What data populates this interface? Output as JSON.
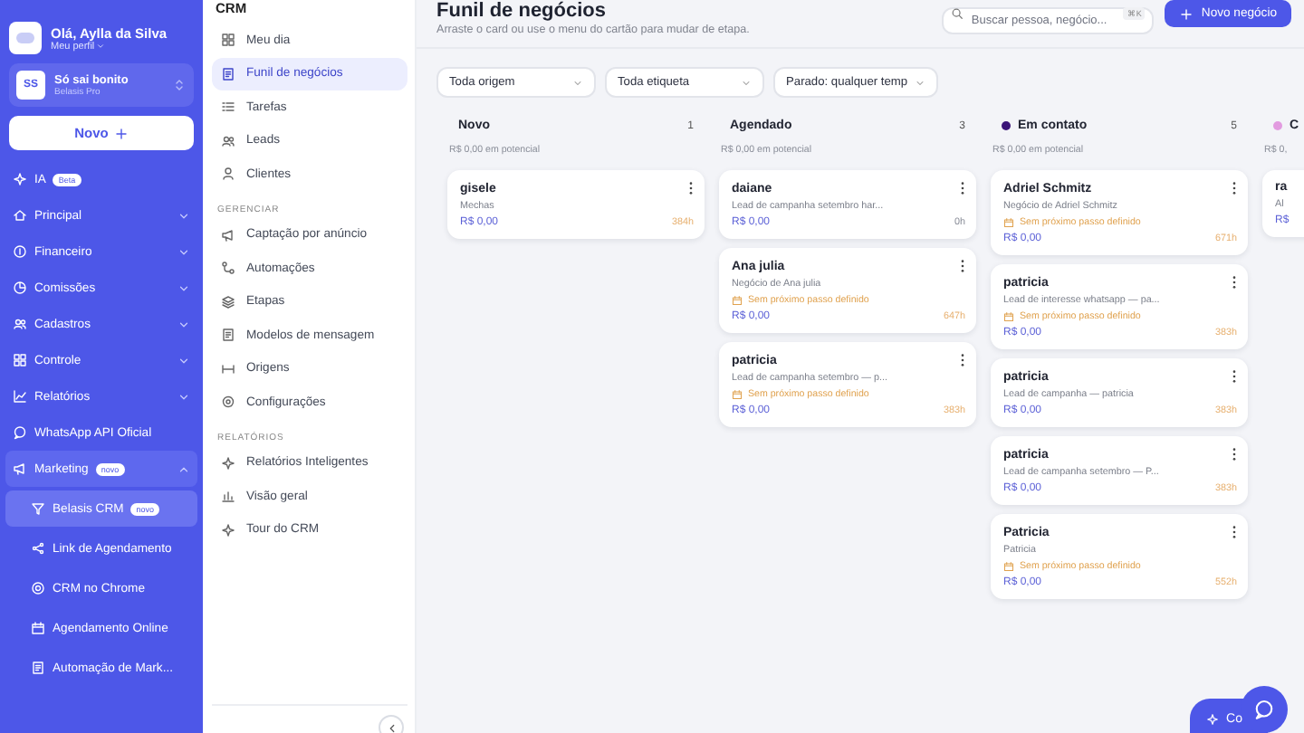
{
  "sidebar": {
    "greeting": "Olá, Aylla da Silva",
    "profile_link": "Meu perfil",
    "workspace": {
      "initials": "SS",
      "name": "Só sai bonito",
      "plan": "Belasis Pro"
    },
    "new_button": "Novo",
    "items": [
      {
        "label": "IA",
        "badge": "Beta",
        "kind": "link"
      },
      {
        "label": "Principal",
        "kind": "group",
        "expanded": false
      },
      {
        "label": "Financeiro",
        "kind": "group",
        "expanded": false
      },
      {
        "label": "Comissões",
        "kind": "group",
        "expanded": false
      },
      {
        "label": "Cadastros",
        "kind": "group",
        "expanded": false
      },
      {
        "label": "Controle",
        "kind": "group",
        "expanded": false
      },
      {
        "label": "Relatórios",
        "kind": "group",
        "expanded": false
      },
      {
        "label": "WhatsApp API Oficial",
        "kind": "link"
      },
      {
        "label": "Marketing",
        "badge": "novo",
        "kind": "group",
        "expanded": true,
        "children": [
          {
            "label": "Belasis CRM",
            "badge": "novo",
            "selected": true
          },
          {
            "label": "Link de Agendamento",
            "selected": false
          },
          {
            "label": "CRM no Chrome",
            "selected": false
          },
          {
            "label": "Agendamento Online",
            "selected": false
          },
          {
            "label": "Automação de Mark...",
            "selected": false
          }
        ]
      }
    ]
  },
  "crm_nav": {
    "title": "CRM",
    "sections": [
      {
        "items": [
          {
            "label": "Meu dia",
            "selected": false
          },
          {
            "label": "Funil de negócios",
            "selected": true
          },
          {
            "label": "Tarefas",
            "selected": false
          },
          {
            "label": "Leads",
            "selected": false
          },
          {
            "label": "Clientes",
            "selected": false
          }
        ]
      },
      {
        "heading": "GERENCIAR",
        "items": [
          {
            "label": "Captação por anúncio",
            "selected": false
          },
          {
            "label": "Automações",
            "selected": false
          },
          {
            "label": "Etapas",
            "selected": false
          },
          {
            "label": "Modelos de mensagem",
            "selected": false
          },
          {
            "label": "Origens",
            "selected": false
          },
          {
            "label": "Configurações",
            "selected": false
          }
        ]
      },
      {
        "heading": "RELATÓRIOS",
        "items": [
          {
            "label": "Relatórios Inteligentes",
            "selected": false
          },
          {
            "label": "Visão geral",
            "selected": false
          },
          {
            "label": "Tour do CRM",
            "selected": false
          }
        ]
      }
    ]
  },
  "header": {
    "title": "Funil de negócios",
    "subtitle": "Arraste o card ou use o menu do cartão para mudar de etapa.",
    "search": {
      "placeholder": "Buscar pessoa, negócio...",
      "shortcut": "⌘K"
    },
    "new_button": "Novo negócio"
  },
  "filters": [
    "Toda origem",
    "Toda etiqueta",
    "Parado: qualquer temp"
  ],
  "columns": [
    {
      "title": "Novo",
      "count": "1",
      "potential": "R$ 0,00 em potencial",
      "cards": [
        {
          "title": "gisele",
          "subtitle": "Mechas",
          "value": "R$ 0,00",
          "age": "384h",
          "stale": true
        }
      ]
    },
    {
      "title": "Agendado",
      "count": "3",
      "potential": "R$ 0,00 em potencial",
      "cards": [
        {
          "title": "daiane",
          "subtitle": "Lead de campanha setembro har...",
          "value": "R$ 0,00",
          "age": "0h",
          "stale": false
        },
        {
          "title": "Ana julia",
          "subtitle": "Negócio de Ana julia",
          "warning": "Sem próximo passo definido",
          "value": "R$ 0,00",
          "age": "647h",
          "stale": true
        },
        {
          "title": "patricia",
          "subtitle": "Lead de campanha setembro — p...",
          "warning": "Sem próximo passo definido",
          "value": "R$ 0,00",
          "age": "383h",
          "stale": true
        }
      ]
    },
    {
      "title": "Em contato",
      "color": "#3b1578",
      "count": "5",
      "potential": "R$ 0,00 em potencial",
      "cards": [
        {
          "title": "Adriel Schmitz",
          "subtitle": "Negócio de Adriel Schmitz",
          "warning": "Sem próximo passo definido",
          "value": "R$ 0,00",
          "age": "671h",
          "stale": true
        },
        {
          "title": "patricia",
          "subtitle": "Lead de interesse whatsapp — pa...",
          "warning": "Sem próximo passo definido",
          "value": "R$ 0,00",
          "age": "383h",
          "stale": true
        },
        {
          "title": "patricia",
          "subtitle": "Lead de campanha — patricia",
          "value": "R$ 0,00",
          "age": "383h",
          "stale": true
        },
        {
          "title": "patricia",
          "subtitle": "Lead de campanha setembro — P...",
          "value": "R$ 0,00",
          "age": "383h",
          "stale": true
        },
        {
          "title": "Patricia",
          "subtitle": "Patricia",
          "warning": "Sem próximo passo definido",
          "value": "R$ 0,00",
          "age": "552h",
          "stale": true
        }
      ]
    },
    {
      "title": "C",
      "color": "#e29be0",
      "potential": "R$ 0,",
      "cards": [
        {
          "title": "ra",
          "subtitle": "Al",
          "value": "R$"
        }
      ]
    }
  ],
  "assistant_button": "Co"
}
